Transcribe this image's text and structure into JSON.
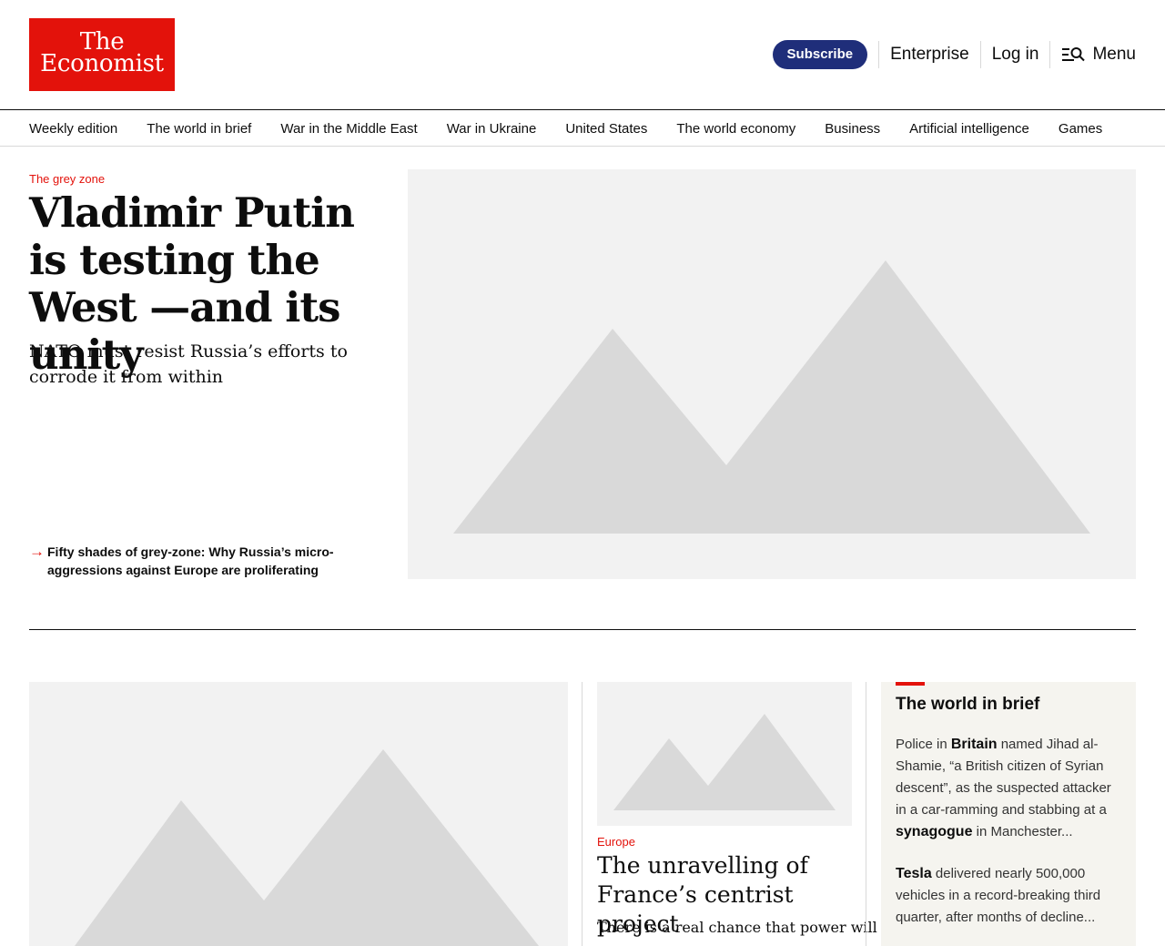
{
  "brand": {
    "logo_line1": "The",
    "logo_line2": "Economist",
    "color": "#e3120b"
  },
  "header": {
    "subscribe": "Subscribe",
    "enterprise": "Enterprise",
    "login": "Log in",
    "menu": "Menu"
  },
  "nav": {
    "items": [
      "Weekly edition",
      "The world in brief",
      "War in the Middle East",
      "War in Ukraine",
      "United States",
      "The world economy",
      "Business",
      "Artificial intelligence",
      "Games"
    ]
  },
  "hero": {
    "kicker": "The grey zone",
    "title": "Vladimir Putin is testing the West —and its unity",
    "subtitle": "NATO must resist Russia’s efforts to corrode it from within",
    "related": "Fifty shades of grey-zone: Why Russia’s micro-aggressions against Europe are proliferating"
  },
  "story": {
    "kicker": "Europe",
    "title": "The unravelling of France’s centrist project",
    "description": "There is a real chance that power will"
  },
  "brief": {
    "heading": "The world in brief",
    "items": [
      {
        "p1": "Police in ",
        "b1": "Britain",
        "p2": " named Jihad al-Shamie, “a British citizen of Syrian descent”, as the suspected attacker in a car-ramming and stabbing at a ",
        "b2": "synagogue",
        "p3": " in Manchester..."
      },
      {
        "b1": "Tesla",
        "p1": " delivered nearly 500,000 vehicles in a record-breaking third quarter, after months of decline..."
      }
    ]
  },
  "colors": {
    "accent": "#e3120b",
    "subscribe_bg": "#1f2e7a",
    "brief_bg": "#f5f4ef",
    "placeholder_bg": "#f2f2f2"
  }
}
